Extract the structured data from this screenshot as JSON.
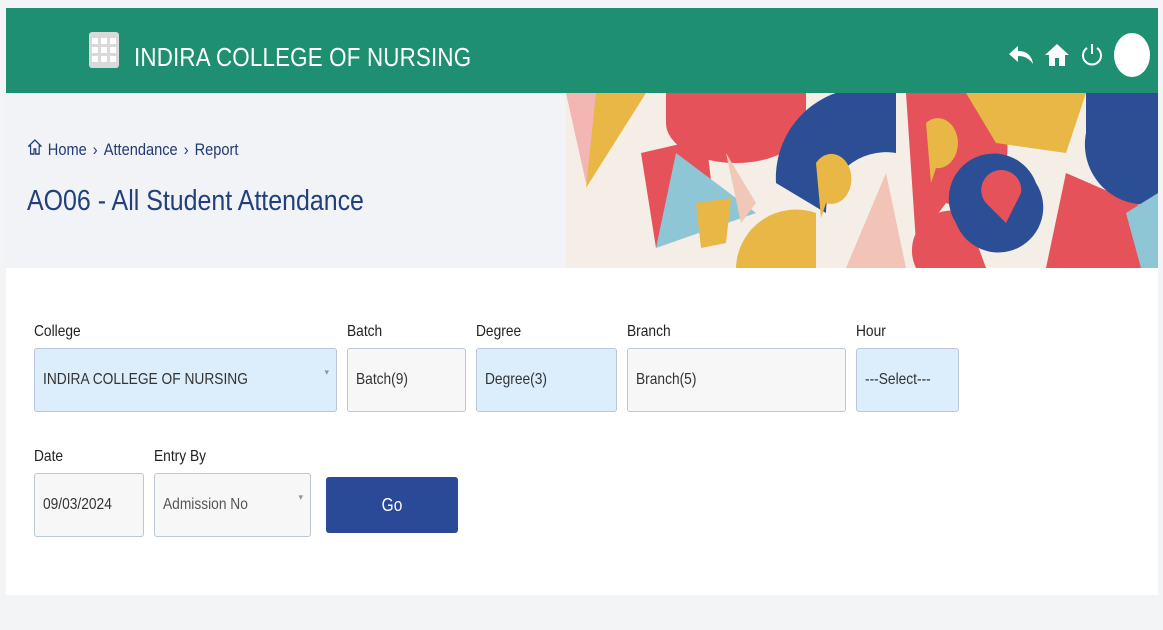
{
  "app": {
    "title": "INDIRA COLLEGE OF NURSING"
  },
  "header_icons": [
    "back-arrow-icon",
    "home-icon",
    "power-icon",
    "avatar"
  ],
  "breadcrumb": {
    "home": "Home",
    "level1": "Attendance",
    "level2": "Report",
    "separator": "›"
  },
  "page": {
    "title": "AO06 - All Student Attendance"
  },
  "form": {
    "college": {
      "label": "College",
      "value": "INDIRA COLLEGE OF NURSING"
    },
    "batch": {
      "label": "Batch",
      "value": "Batch(9)"
    },
    "degree": {
      "label": "Degree",
      "value": "Degree(3)"
    },
    "branch": {
      "label": "Branch",
      "value": "Branch(5)"
    },
    "hour": {
      "label": "Hour",
      "value": "---Select---"
    },
    "date": {
      "label": "Date",
      "value": "09/03/2024"
    },
    "entry_by": {
      "label": "Entry By",
      "value": "Admission No"
    },
    "go_label": "Go"
  },
  "colors": {
    "topbar": "#1f8f72",
    "accent_button": "#2a4a97",
    "title_text": "#22407a",
    "field_blue": "#dcedfb"
  }
}
